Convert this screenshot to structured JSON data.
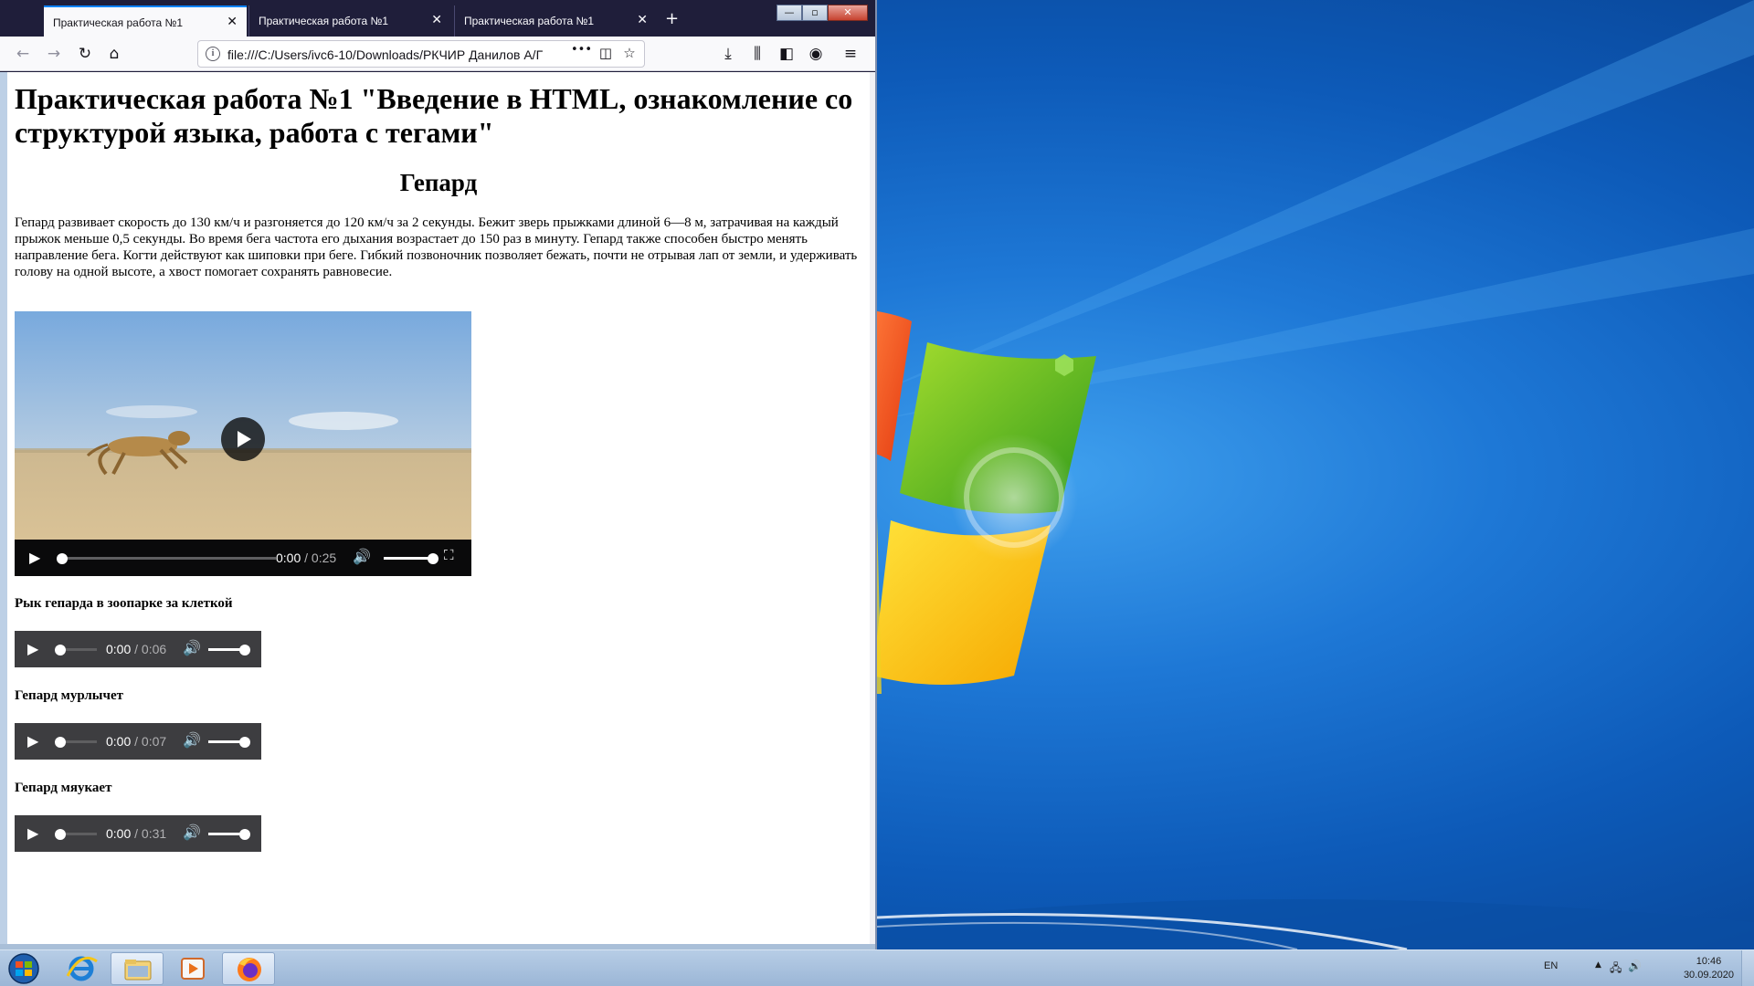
{
  "browser": {
    "tabs": [
      {
        "title": "Практическая работа №1",
        "active": true
      },
      {
        "title": "Практическая работа №1",
        "active": false
      },
      {
        "title": "Практическая работа №1",
        "active": false
      }
    ],
    "close_glyph": "✕",
    "new_tab_glyph": "+",
    "url": "file:///C:/Users/ivc6-10/Downloads/РКЧИР Данилов А/Г",
    "more_glyph": "•••"
  },
  "window_controls": {
    "minimize": "—",
    "maximize": "▫",
    "close": "✕"
  },
  "page": {
    "title": "Практическая работа №1 \"Введение в HTML, ознакомление со структурой языка, работа с тегами\"",
    "heading": "Гепард",
    "paragraph": "Гепард развивает скорость до 130 км/ч и разгоняется до 120 км/ч за 2 секунды. Бежит зверь прыжками длиной 6—8 м, затрачивая на каждый прыжок меньше 0,5 секунды. Во время бега частота его дыхания возрастает до 150 раз в минуту. Гепард также способен быстро менять направление бега. Когти действуют как шиповки при беге. Гибкий позвоночник позволяет бежать, почти не отрывая лап от земли, и удерживать голову на одной высоте, а хвост помогает сохранять равновесие.",
    "video": {
      "current": "0:00",
      "sep": "/",
      "duration": "0:25",
      "progress": 0.0,
      "volume": 1.0
    },
    "audios": [
      {
        "label": "Рык гепарда в зоопарке за клеткой",
        "current": "0:00",
        "sep": "/",
        "duration": "0:06",
        "progress": 0.0,
        "volume": 1.0
      },
      {
        "label": "Гепард мурлычет",
        "current": "0:00",
        "sep": "/",
        "duration": "0:07",
        "progress": 0.0,
        "volume": 1.0
      },
      {
        "label": "Гепард мяукает",
        "current": "0:00",
        "sep": "/",
        "duration": "0:31",
        "progress": 0.0,
        "volume": 1.0
      }
    ]
  },
  "taskbar": {
    "lang": "EN",
    "time": "10:46",
    "date": "30.09.2020",
    "apps": [
      "windows-explorer",
      "internet-explorer",
      "libraries",
      "media-player",
      "firefox"
    ]
  },
  "colors": {
    "accent": "#0a84ff",
    "tabbar": "#1f1e3a",
    "desktop": "#1e78d6"
  }
}
